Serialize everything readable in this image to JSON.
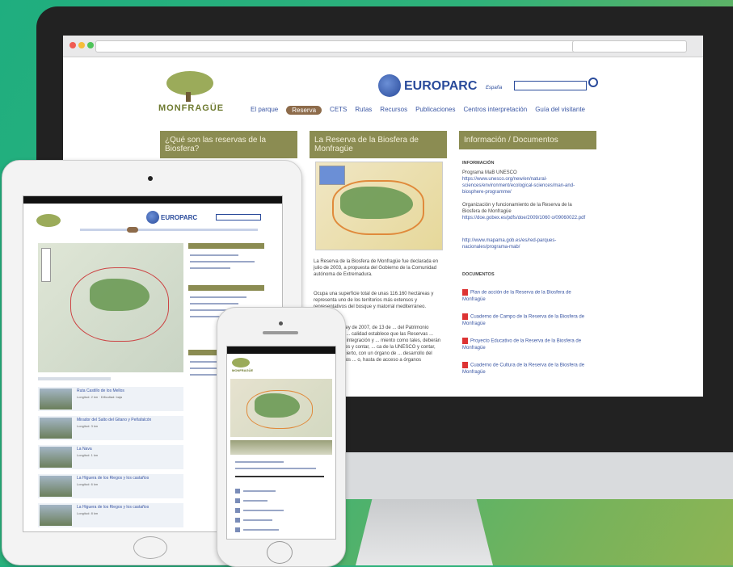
{
  "desktop": {
    "euro_brand": "EUROPARC",
    "euro_sub": "España",
    "logo_text": "MONFRAGÜE",
    "nav": [
      {
        "label": "El parque"
      },
      {
        "label": "Reserva",
        "active": true
      },
      {
        "label": "CETS"
      },
      {
        "label": "Rutas"
      },
      {
        "label": "Recursos"
      },
      {
        "label": "Publicaciones"
      },
      {
        "label": "Centros interpretación"
      },
      {
        "label": "Guía del visitante"
      }
    ],
    "col1_title": "¿Qué son las reservas de la Biosfera?",
    "col2_title": "La Reserva de la Biosfera de Monfragüe",
    "col3_title": "Información / Documentos",
    "col2_text_1": "La Reserva de la Biosfera de Monfragüe fue declarada en julio de 2003, a propuesta del Gobierno de la Comunidad autónoma de Extremadura.",
    "col2_text_2": "Ocupa una superficie total de unas 116.160 hectáreas y representa uno de los territorios más extensos y representativos del bosque y matorral mediterráneo.",
    "col2_text_3": "... el 67 de la Ley de 2007, de 13 de ... del Patrimonio Natural y de la ... calidad establece que las Reservas ... nticos, para su integración y ... miento como tales, deberán ... das directrices y contar, ... ca de la UNESCO y contar, como ... nimo cierto, con un órgano de ... desarrollo del desarrollo de dos ... o, hasta de acceso a órganos",
    "info_heading": "INFORMACIÓN",
    "info_1_title": "Programa MaB UNESCO",
    "info_1_link": "https://www.unesco.org/new/en/natural-sciences/environment/ecological-sciences/man-and-biosphere-programme/",
    "info_2_title": "Organización y funcionamiento de la Reserva de la Biosfera de Monfragüe",
    "info_2_link": "https://doe.gobex.es/pdfs/doe/2009/1060 o/09060022.pdf",
    "info_3_link": "http://www.mapama.gob.es/es/red-parques-nacionales/programa-mab/",
    "docs_heading": "DOCUMENTOS",
    "doc_1": "Plan de acción de la Reserva de la Biosfera de Monfragüe",
    "doc_2": "Cuaderno de Campo de la Reserva de la Biosfera de Monfragüe",
    "doc_3": "Proyecto Educativo de la Reserva de la Biosfera de Monfragüe",
    "doc_4": "Cuaderno de Cultura de la Reserva de la Biosfera de Monfragüe"
  },
  "tablet": {
    "euro_brand": "EUROPARC",
    "list": [
      {
        "title": "Ruta Castillo de los Mellos",
        "sub": "Longitud: 2 km · Dificultad: baja"
      },
      {
        "title": "Mirador del Salto del Gitano y Peñafalcón",
        "sub": "Longitud: 3 km"
      },
      {
        "title": "La Nava",
        "sub": "Longitud: 1 km"
      },
      {
        "title": "La Higuera de los Riegos y los castaños",
        "sub": "Longitud: 6 km"
      },
      {
        "title": "La Higuera de los Riegos y los castaños",
        "sub": "Longitud: 8 km"
      }
    ]
  },
  "phone": {
    "title": "MONFRAGÜE"
  }
}
